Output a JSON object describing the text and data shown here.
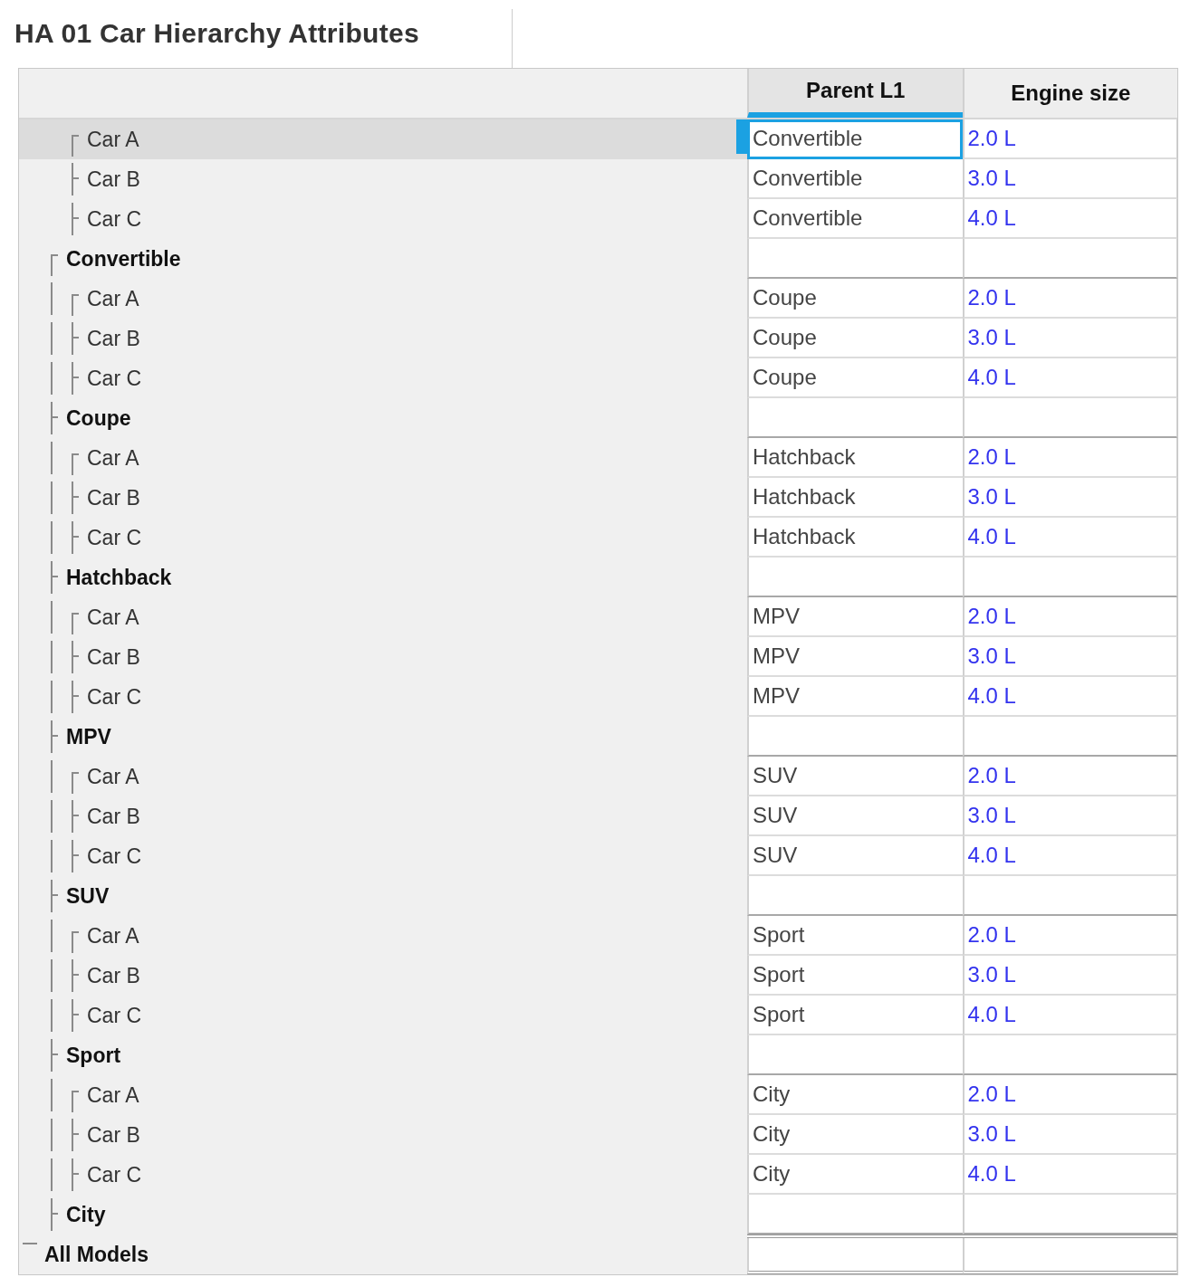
{
  "title": "HA 01 Car Hierarchy Attributes",
  "columns": [
    "Parent L1",
    "Engine size"
  ],
  "tree": {
    "label": "All Models",
    "selected": false,
    "children": [
      {
        "label": "Convertible",
        "selected": false,
        "children": [
          {
            "label": "Car A",
            "selected": true,
            "parent_l1": "Convertible",
            "engine_size": "2.0 L"
          },
          {
            "label": "Car B",
            "selected": false,
            "parent_l1": "Convertible",
            "engine_size": "3.0 L"
          },
          {
            "label": "Car C",
            "selected": false,
            "parent_l1": "Convertible",
            "engine_size": "4.0 L"
          }
        ]
      },
      {
        "label": "Coupe",
        "selected": false,
        "children": [
          {
            "label": "Car A",
            "selected": false,
            "parent_l1": "Coupe",
            "engine_size": "2.0 L"
          },
          {
            "label": "Car B",
            "selected": false,
            "parent_l1": "Coupe",
            "engine_size": "3.0 L"
          },
          {
            "label": "Car C",
            "selected": false,
            "parent_l1": "Coupe",
            "engine_size": "4.0 L"
          }
        ]
      },
      {
        "label": "Hatchback",
        "selected": false,
        "children": [
          {
            "label": "Car A",
            "selected": false,
            "parent_l1": "Hatchback",
            "engine_size": "2.0 L"
          },
          {
            "label": "Car B",
            "selected": false,
            "parent_l1": "Hatchback",
            "engine_size": "3.0 L"
          },
          {
            "label": "Car C",
            "selected": false,
            "parent_l1": "Hatchback",
            "engine_size": "4.0 L"
          }
        ]
      },
      {
        "label": "MPV",
        "selected": false,
        "children": [
          {
            "label": "Car A",
            "selected": false,
            "parent_l1": "MPV",
            "engine_size": "2.0 L"
          },
          {
            "label": "Car B",
            "selected": false,
            "parent_l1": "MPV",
            "engine_size": "3.0 L"
          },
          {
            "label": "Car C",
            "selected": false,
            "parent_l1": "MPV",
            "engine_size": "4.0 L"
          }
        ]
      },
      {
        "label": "SUV",
        "selected": false,
        "children": [
          {
            "label": "Car A",
            "selected": false,
            "parent_l1": "SUV",
            "engine_size": "2.0 L"
          },
          {
            "label": "Car B",
            "selected": false,
            "parent_l1": "SUV",
            "engine_size": "3.0 L"
          },
          {
            "label": "Car C",
            "selected": false,
            "parent_l1": "SUV",
            "engine_size": "4.0 L"
          }
        ]
      },
      {
        "label": "Sport",
        "selected": false,
        "children": [
          {
            "label": "Car A",
            "selected": false,
            "parent_l1": "Sport",
            "engine_size": "2.0 L"
          },
          {
            "label": "Car B",
            "selected": false,
            "parent_l1": "Sport",
            "engine_size": "3.0 L"
          },
          {
            "label": "Car C",
            "selected": false,
            "parent_l1": "Sport",
            "engine_size": "4.0 L"
          }
        ]
      },
      {
        "label": "City",
        "selected": false,
        "children": [
          {
            "label": "Car A",
            "selected": false,
            "parent_l1": "City",
            "engine_size": "2.0 L"
          },
          {
            "label": "Car B",
            "selected": false,
            "parent_l1": "City",
            "engine_size": "3.0 L"
          },
          {
            "label": "Car C",
            "selected": false,
            "parent_l1": "City",
            "engine_size": "4.0 L"
          }
        ]
      }
    ]
  }
}
